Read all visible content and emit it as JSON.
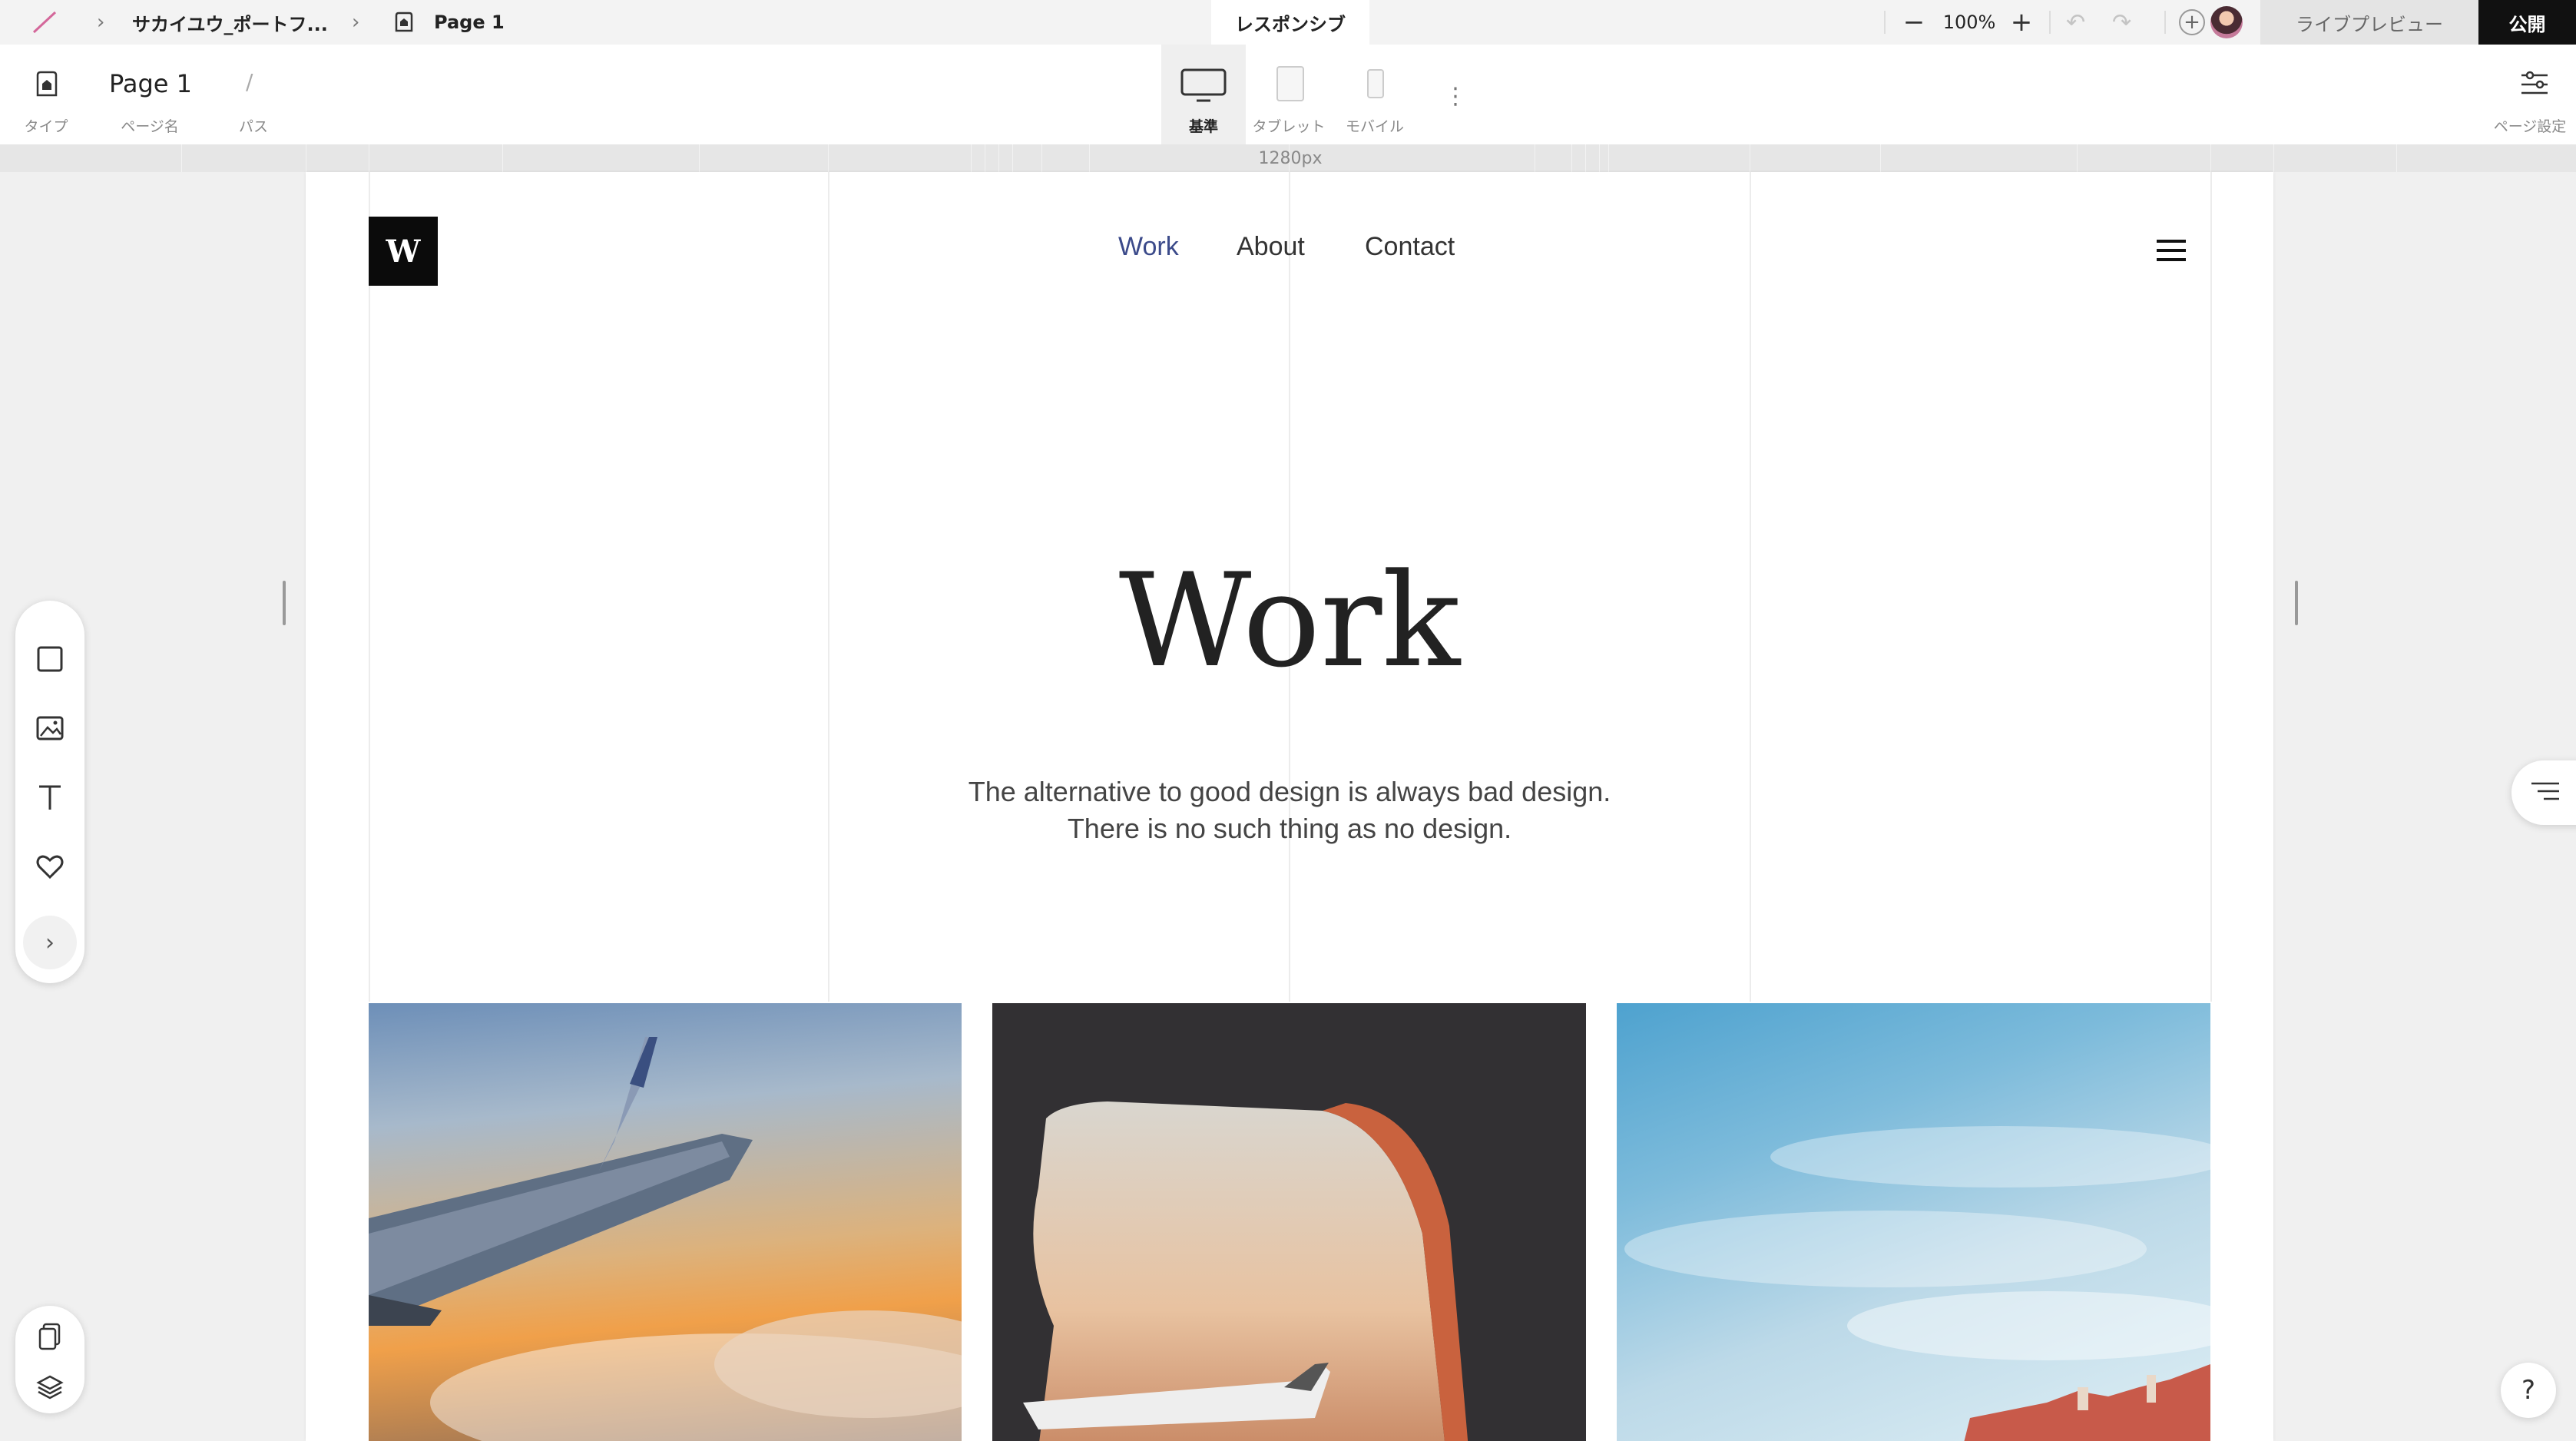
{
  "topbar": {
    "project_name": "サカイユウ_ポートフ...",
    "page_crumb": "Page 1",
    "center_tab": "レスポンシブ",
    "zoom": "100%",
    "live_preview": "ライブプレビュー",
    "publish": "公開"
  },
  "toolbar": {
    "page_name": "Page 1",
    "path": "/",
    "label_type": "タイプ",
    "label_page_name": "ページ名",
    "label_path": "パス",
    "device_desktop": "基準",
    "device_tablet": "タブレット",
    "device_mobile": "モバイル",
    "page_settings": "ページ設定"
  },
  "ruler": {
    "width_label": "1280px"
  },
  "site": {
    "logo": "W",
    "nav": [
      "Work",
      "About",
      "Contact"
    ],
    "hero_title": "Work",
    "tagline_line1": "The alternative to good design is always bad design.",
    "tagline_line2": "There is no such thing as no design."
  },
  "colors": {
    "accent_nav": "#3b4a8a",
    "publish_bg": "#111111",
    "canvas_bg": "#ffffff"
  },
  "icons": [
    "pen-icon",
    "home-page-icon",
    "monitor-icon",
    "tablet-icon",
    "mobile-icon",
    "more-vertical-icon",
    "settings-sliders-icon",
    "square-icon",
    "image-icon",
    "text-icon",
    "heart-icon",
    "chevron-right-icon",
    "pages-icon",
    "layers-icon",
    "outline-icon",
    "help-icon"
  ]
}
